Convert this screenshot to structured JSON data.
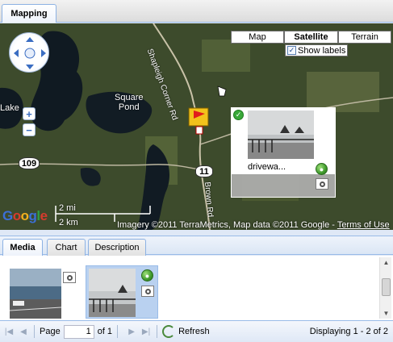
{
  "top_tabs": [
    {
      "label": "Mapping"
    }
  ],
  "map": {
    "map_types": {
      "map": "Map",
      "satellite": "Satellite",
      "terrain": "Terrain"
    },
    "show_labels": {
      "label": "Show labels",
      "checked": true
    },
    "zoom": {
      "in": "+",
      "out": "−"
    },
    "labels": {
      "square_pond": [
        "Square",
        "Pond"
      ],
      "lake": "Lake",
      "road_north": "Shapleigh Corner Rd",
      "road_south": "Brown Rd"
    },
    "routes": [
      "109",
      "11"
    ],
    "scale": {
      "miles": "2 mi",
      "km": "2 km"
    },
    "attribution": "Imagery ©2011 TerraMetrics, Map data ©2011 Google - ",
    "terms_link": "Terms of Use",
    "logo": "Google",
    "popup": {
      "caption": "drivewa..."
    }
  },
  "bottom_tabs": [
    {
      "label": "Media"
    },
    {
      "label": "Chart"
    },
    {
      "label": "Description"
    }
  ],
  "pager": {
    "page_label": "Page",
    "page_value": "1",
    "of_label": "of 1",
    "refresh_label": "Refresh",
    "display_info": "Displaying 1 - 2 of 2"
  },
  "colors": {
    "accent": "#99bbe8",
    "selection": "#b9d1f0"
  }
}
